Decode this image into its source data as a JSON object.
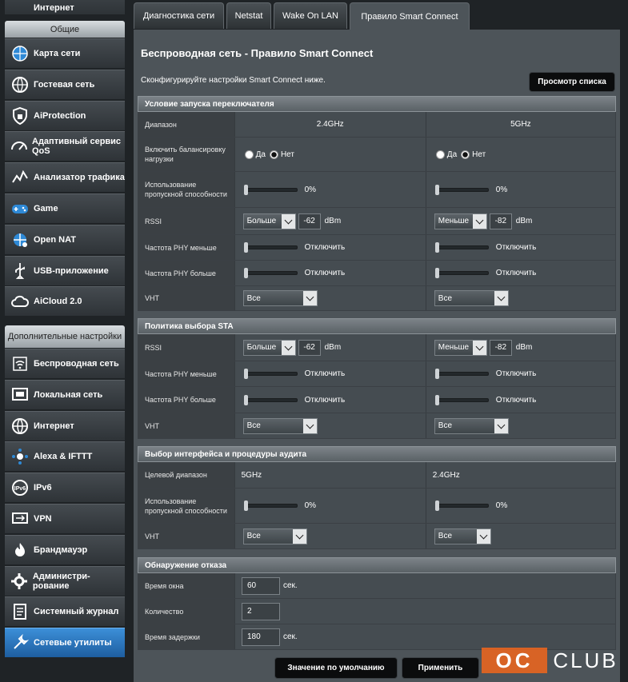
{
  "sidebar": {
    "top_partial": "Интернет",
    "general_header": "Общие",
    "general_items": [
      {
        "label": "Карта сети",
        "icon": "network-map-icon"
      },
      {
        "label": "Гостевая сеть",
        "icon": "guest-network-icon"
      },
      {
        "label": "AiProtection",
        "icon": "shield-lock-icon"
      },
      {
        "label": "Адаптивный сервис QoS",
        "icon": "speedometer-icon"
      },
      {
        "label": "Анализатор трафика",
        "icon": "traffic-graph-icon"
      },
      {
        "label": "Game",
        "icon": "gamepad-icon"
      },
      {
        "label": "Open NAT",
        "icon": "open-nat-icon"
      },
      {
        "label": "USB-приложение",
        "icon": "usb-icon"
      },
      {
        "label": "AiCloud 2.0",
        "icon": "cloud-icon"
      }
    ],
    "advanced_header": "Дополнительные настройки",
    "advanced_items": [
      {
        "label": "Беспроводная сеть",
        "icon": "wireless-icon"
      },
      {
        "label": "Локальная сеть",
        "icon": "lan-icon"
      },
      {
        "label": "Интернет",
        "icon": "globe-icon"
      },
      {
        "label": "Alexa & IFTTT",
        "icon": "alexa-icon"
      },
      {
        "label": "IPv6",
        "icon": "ipv6-icon"
      },
      {
        "label": "VPN",
        "icon": "vpn-icon"
      },
      {
        "label": "Брандмауэр",
        "icon": "firewall-icon"
      },
      {
        "label": "Администри- рование",
        "icon": "admin-gear-icon"
      },
      {
        "label": "Системный журнал",
        "icon": "system-log-icon"
      },
      {
        "label": "Сетевые утилиты",
        "icon": "network-tools-icon"
      }
    ],
    "active_item": "Сетевые утилиты"
  },
  "tabs": [
    "Диагностика сети",
    "Netstat",
    "Wake On LAN",
    "Правило Smart Connect"
  ],
  "active_tab": "Правило Smart Connect",
  "page": {
    "title": "Беспроводная сеть - Правило Smart Connect",
    "description": "Сконфигурируйте настройки Smart Connect ниже.",
    "view_list_button": "Просмотр списка"
  },
  "trigger": {
    "header": "Условие запуска переключателя",
    "band_label": "Диапазон",
    "band_24": "2.4GHz",
    "band_5": "5GHz",
    "load_balance_label": "Включить балансировку нагрузки",
    "yes": "Да",
    "no": "Нет",
    "load_balance_24": "Нет",
    "load_balance_5": "Нет",
    "bandwidth_label": "Использование пропускной способности",
    "bw_24": "0%",
    "bw_5": "0%",
    "bw_24_level": 0,
    "bw_5_level": 0,
    "rssi_label": "RSSI",
    "rssi_24_op": "Больше",
    "rssi_24_val": "-62",
    "rssi_5_op": "Меньше",
    "rssi_5_val": "-82",
    "dbm": "dBm",
    "phy_less_label": "Частота PHY меньше",
    "phy_more_label": "Частота PHY больше",
    "disable": "Отключить",
    "vht_label": "VHT",
    "vht_24": "Все",
    "vht_5": "Все"
  },
  "sta": {
    "header": "Политика выбора STA",
    "rssi_label": "RSSI",
    "rssi_24_op": "Больше",
    "rssi_24_val": "-62",
    "rssi_5_op": "Меньше",
    "rssi_5_val": "-82",
    "dbm": "dBm",
    "phy_less_label": "Частота PHY меньше",
    "phy_more_label": "Частота PHY больше",
    "disable": "Отключить",
    "vht_label": "VHT",
    "vht_24": "Все",
    "vht_5": "Все"
  },
  "iface": {
    "header": "Выбор интерфейса и процедуры аудита",
    "target_label": "Целевой диапазон",
    "target_24": "5GHz",
    "target_5": "2.4GHz",
    "bandwidth_label": "Использование пропускной способности",
    "bw_24": "0%",
    "bw_5": "0%",
    "bw_24_level": 0,
    "bw_5_level": 0,
    "vht_label": "VHT",
    "vht_24": "Все",
    "vht_5": "Все"
  },
  "failure": {
    "header": "Обнаружение отказа",
    "window_label": "Время окна",
    "window_val": "60",
    "count_label": "Количество",
    "count_val": "2",
    "delay_label": "Время задержки",
    "delay_val": "180",
    "sec": "сек."
  },
  "buttons": {
    "default": "Значение по умолчанию",
    "apply": "Применить"
  },
  "watermark": "OC CLUB",
  "colors": {
    "active_nav": "#2a76c0",
    "logo_orange": "#e8651f",
    "panel": "#4d5459"
  }
}
